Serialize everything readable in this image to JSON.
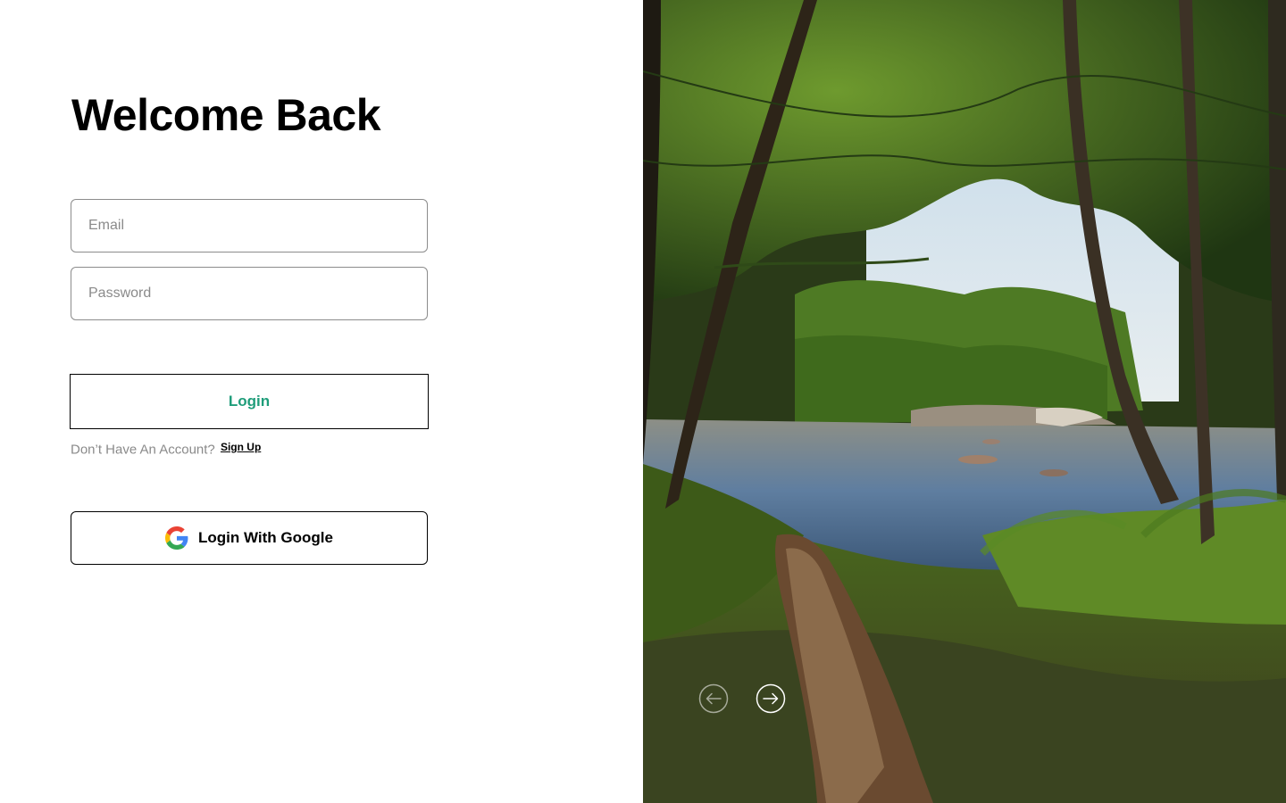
{
  "login": {
    "title": "Welcome Back",
    "email_placeholder": "Email",
    "password_placeholder": "Password",
    "login_label": "Login",
    "signup_prompt": "Don’t Have An Account?",
    "signup_link": "Sign Up",
    "google_label": "Login With Google"
  },
  "carousel": {
    "prev_icon": "arrow-left-circle-icon",
    "next_icon": "arrow-right-circle-icon"
  },
  "colors": {
    "accent": "#1f9d7a",
    "text": "#000000",
    "muted": "#8a8a8a",
    "field_border": "#8c8c8c"
  }
}
